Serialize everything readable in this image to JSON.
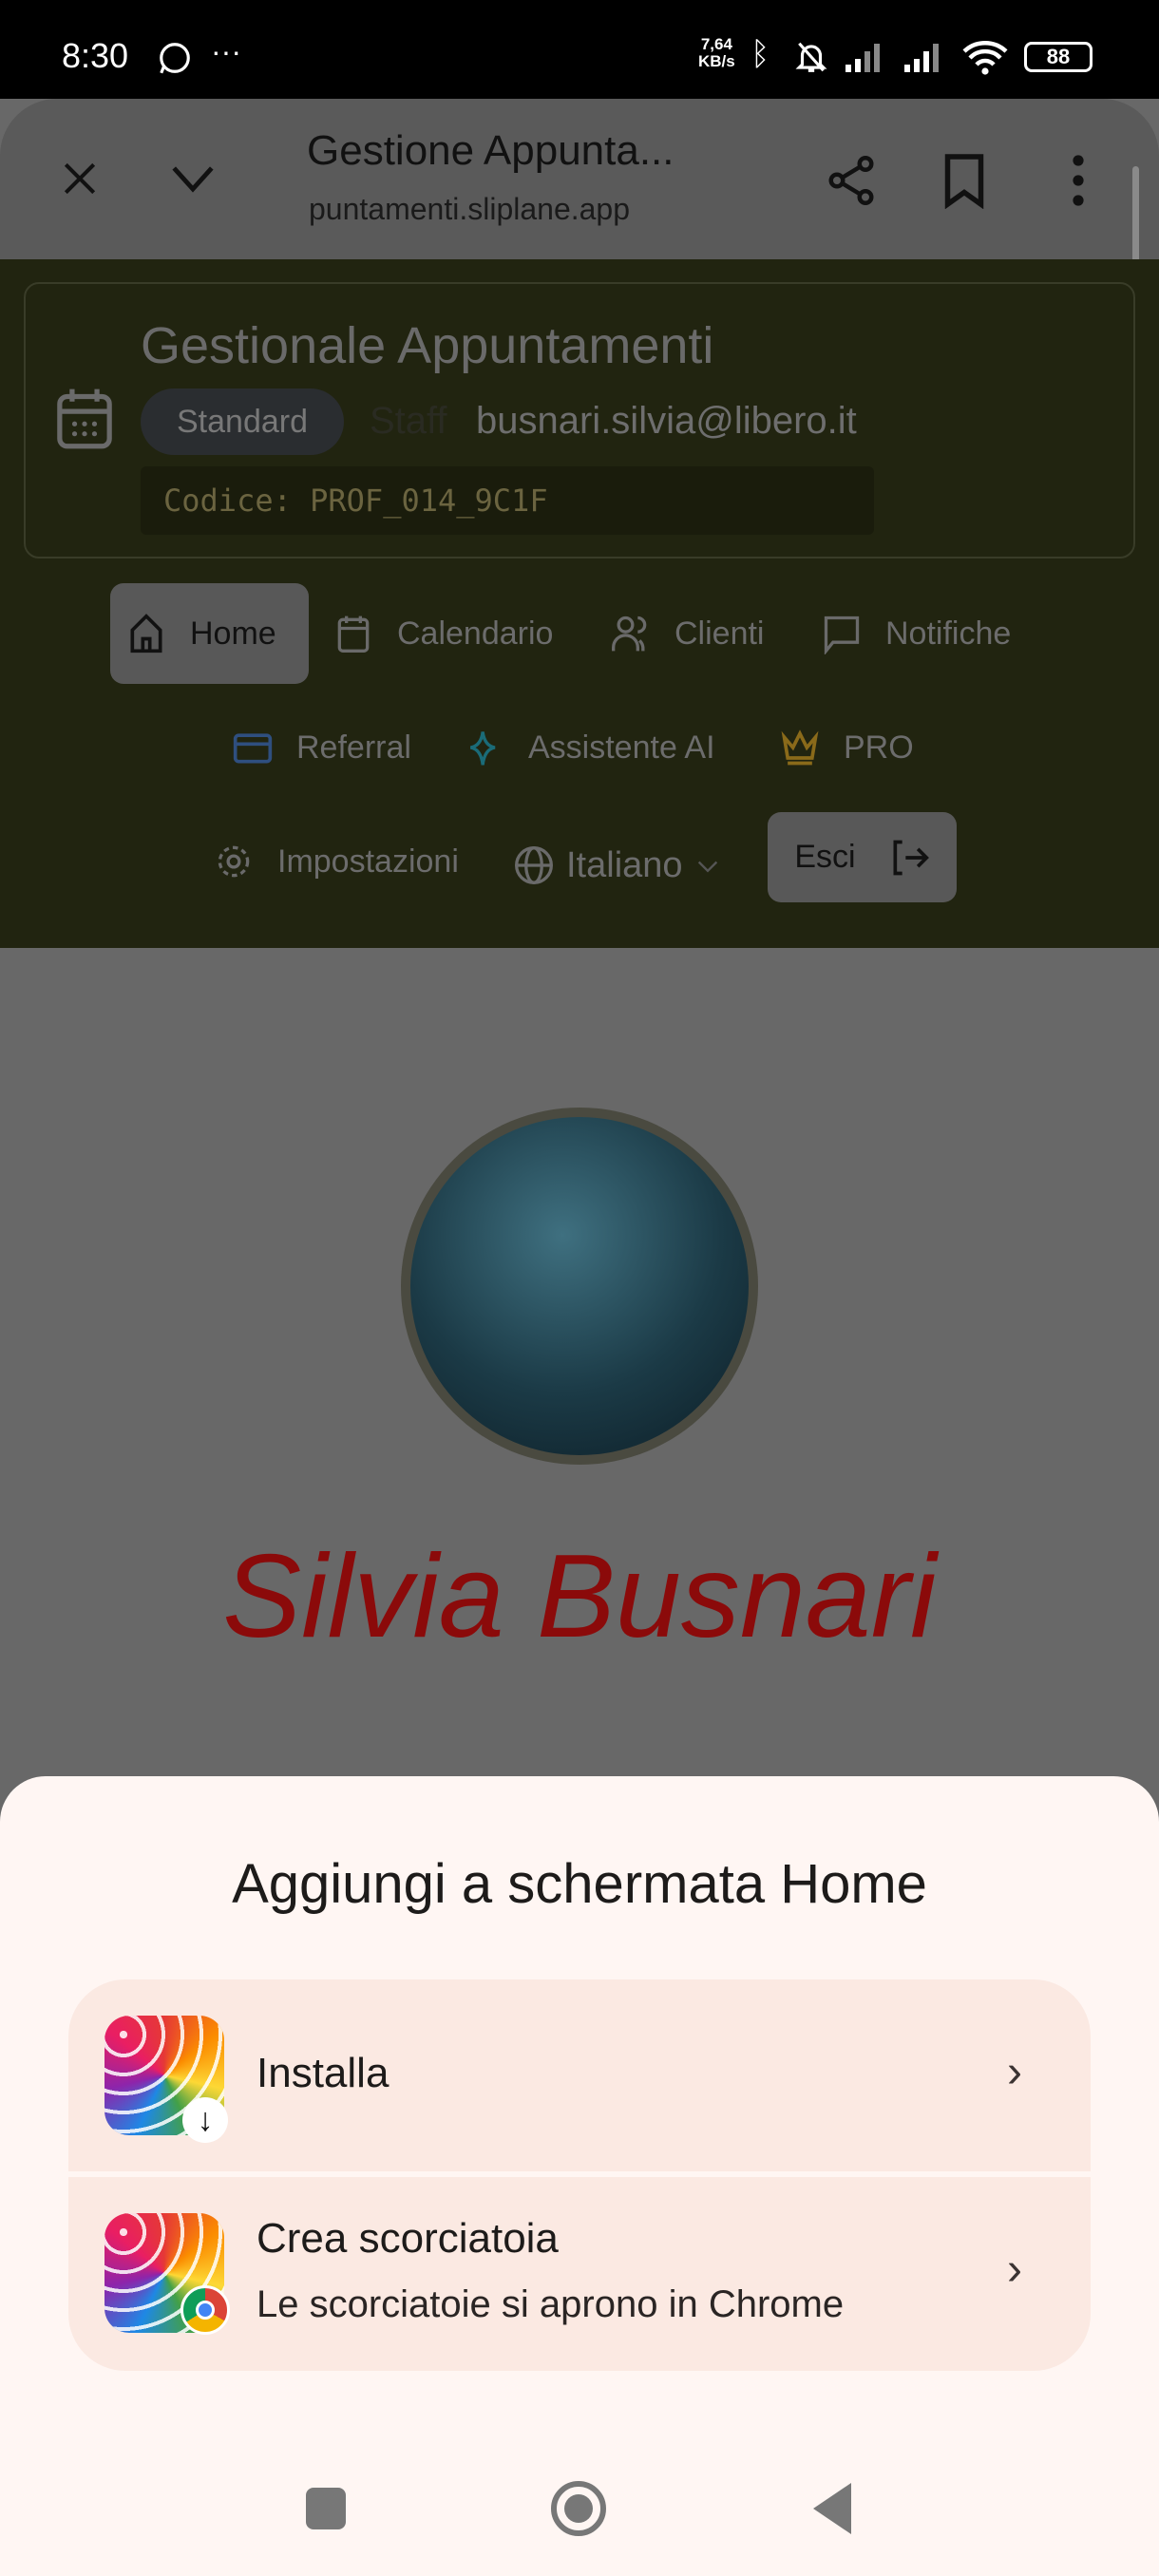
{
  "status_bar": {
    "time": "8:30",
    "more": "···",
    "net_speed": "7,64",
    "net_unit": "KB/s",
    "battery": "88"
  },
  "browser": {
    "title": "Gestione Appunta...",
    "url": "puntamenti.sliplane.app"
  },
  "app": {
    "title": "Gestionale Appuntamenti",
    "plan_badge": "Standard",
    "role": "Staff",
    "email": "busnari.silvia@libero.it",
    "code": "Codice: PROF_014_9C1F",
    "nav": [
      {
        "label": "Home",
        "icon": "home-icon",
        "active": true
      },
      {
        "label": "Calendario",
        "icon": "calendar-icon"
      },
      {
        "label": "Clienti",
        "icon": "users-icon"
      },
      {
        "label": "Notifiche",
        "icon": "message-icon"
      },
      {
        "label": "Referral",
        "icon": "card-icon",
        "color": "#2f4f7f"
      },
      {
        "label": "Assistente AI",
        "icon": "sparkle-icon",
        "color": "#1a6b78"
      },
      {
        "label": "PRO",
        "icon": "crown-icon",
        "color": "#8a6a1a"
      },
      {
        "label": "Impostazioni",
        "icon": "gear-icon"
      }
    ],
    "language": "Italiano",
    "logout": "Esci"
  },
  "profile": {
    "name": "Silvia Busnari",
    "name_color": "#8b0a0a"
  },
  "sheet": {
    "title": "Aggiungi a schermata Home",
    "options": [
      {
        "label": "Installa"
      },
      {
        "label": "Crea scorciatoia",
        "sublabel": "Le scorciatoie si aprono in Chrome"
      }
    ]
  }
}
